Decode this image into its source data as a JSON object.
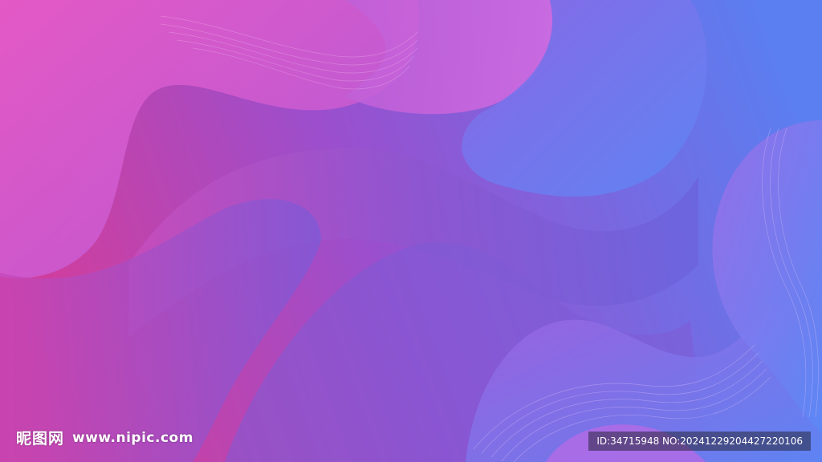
{
  "watermark": {
    "site_name": "昵图网",
    "site_url": "www.nipic.com",
    "image_id": "ID:34715948 NO:20241229204427220106"
  },
  "colors": {
    "pink": "#e0409c",
    "magenta": "#d45ad6",
    "violet": "#8e5cdc",
    "blue": "#5a7ef2"
  }
}
